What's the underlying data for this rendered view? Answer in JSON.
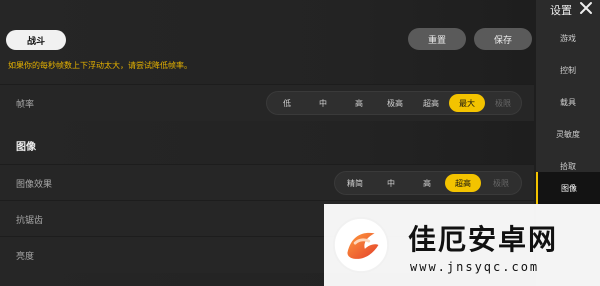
{
  "header": {
    "mode_label": "战斗",
    "reset_label": "重置",
    "save_label": "保存"
  },
  "hint": "如果你的每秒帧数上下浮动太大，请尝试降低帧率。",
  "rows": {
    "framerate": {
      "label": "帧率",
      "options": [
        "低",
        "中",
        "高",
        "极高",
        "超高",
        "最大",
        "极限"
      ],
      "selected": "最大",
      "disabled": [
        "极限"
      ]
    },
    "section_image": "图像",
    "image_effect": {
      "label": "图像效果",
      "options": [
        "精简",
        "中",
        "高",
        "超高",
        "极限"
      ],
      "selected": "超高",
      "disabled": [
        "极限"
      ]
    },
    "antialias": {
      "label": "抗锯齿"
    },
    "brightness": {
      "label": "亮度"
    }
  },
  "sidebar": {
    "title": "设置",
    "items": [
      {
        "label": "游戏"
      },
      {
        "label": "控制"
      },
      {
        "label": "载具"
      },
      {
        "label": "灵敏度"
      },
      {
        "label": "拾取"
      },
      {
        "label": "图像",
        "active": true
      }
    ],
    "active_color": "#f3c300"
  },
  "watermark": {
    "brand_cn": "佳厄安卓网",
    "brand_url": "www.jnsyqc.com"
  },
  "colors": {
    "accent": "#f3c300",
    "hint": "#e7b300"
  },
  "icons": {
    "close": "close-icon",
    "watermark_logo": "phoenix-logo"
  }
}
